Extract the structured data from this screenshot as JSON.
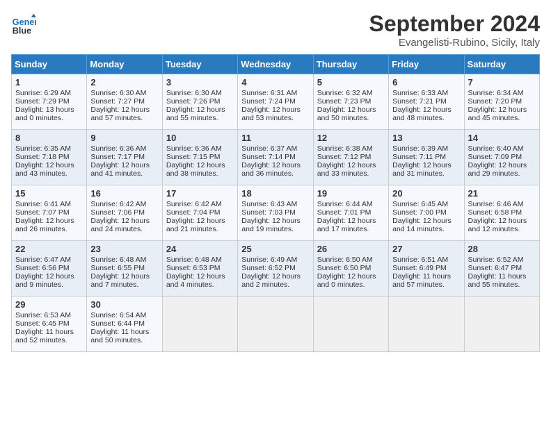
{
  "logo": {
    "line1": "General",
    "line2": "Blue"
  },
  "title": "September 2024",
  "subtitle": "Evangelisti-Rubino, Sicily, Italy",
  "days_header": [
    "Sunday",
    "Monday",
    "Tuesday",
    "Wednesday",
    "Thursday",
    "Friday",
    "Saturday"
  ],
  "weeks": [
    [
      {
        "day": "1",
        "sunrise": "6:29 AM",
        "sunset": "7:29 PM",
        "daylight": "13 hours and 0 minutes."
      },
      {
        "day": "2",
        "sunrise": "6:30 AM",
        "sunset": "7:27 PM",
        "daylight": "12 hours and 57 minutes."
      },
      {
        "day": "3",
        "sunrise": "6:30 AM",
        "sunset": "7:26 PM",
        "daylight": "12 hours and 55 minutes."
      },
      {
        "day": "4",
        "sunrise": "6:31 AM",
        "sunset": "7:24 PM",
        "daylight": "12 hours and 53 minutes."
      },
      {
        "day": "5",
        "sunrise": "6:32 AM",
        "sunset": "7:23 PM",
        "daylight": "12 hours and 50 minutes."
      },
      {
        "day": "6",
        "sunrise": "6:33 AM",
        "sunset": "7:21 PM",
        "daylight": "12 hours and 48 minutes."
      },
      {
        "day": "7",
        "sunrise": "6:34 AM",
        "sunset": "7:20 PM",
        "daylight": "12 hours and 45 minutes."
      }
    ],
    [
      {
        "day": "8",
        "sunrise": "6:35 AM",
        "sunset": "7:18 PM",
        "daylight": "12 hours and 43 minutes."
      },
      {
        "day": "9",
        "sunrise": "6:36 AM",
        "sunset": "7:17 PM",
        "daylight": "12 hours and 41 minutes."
      },
      {
        "day": "10",
        "sunrise": "6:36 AM",
        "sunset": "7:15 PM",
        "daylight": "12 hours and 38 minutes."
      },
      {
        "day": "11",
        "sunrise": "6:37 AM",
        "sunset": "7:14 PM",
        "daylight": "12 hours and 36 minutes."
      },
      {
        "day": "12",
        "sunrise": "6:38 AM",
        "sunset": "7:12 PM",
        "daylight": "12 hours and 33 minutes."
      },
      {
        "day": "13",
        "sunrise": "6:39 AM",
        "sunset": "7:11 PM",
        "daylight": "12 hours and 31 minutes."
      },
      {
        "day": "14",
        "sunrise": "6:40 AM",
        "sunset": "7:09 PM",
        "daylight": "12 hours and 29 minutes."
      }
    ],
    [
      {
        "day": "15",
        "sunrise": "6:41 AM",
        "sunset": "7:07 PM",
        "daylight": "12 hours and 26 minutes."
      },
      {
        "day": "16",
        "sunrise": "6:42 AM",
        "sunset": "7:06 PM",
        "daylight": "12 hours and 24 minutes."
      },
      {
        "day": "17",
        "sunrise": "6:42 AM",
        "sunset": "7:04 PM",
        "daylight": "12 hours and 21 minutes."
      },
      {
        "day": "18",
        "sunrise": "6:43 AM",
        "sunset": "7:03 PM",
        "daylight": "12 hours and 19 minutes."
      },
      {
        "day": "19",
        "sunrise": "6:44 AM",
        "sunset": "7:01 PM",
        "daylight": "12 hours and 17 minutes."
      },
      {
        "day": "20",
        "sunrise": "6:45 AM",
        "sunset": "7:00 PM",
        "daylight": "12 hours and 14 minutes."
      },
      {
        "day": "21",
        "sunrise": "6:46 AM",
        "sunset": "6:58 PM",
        "daylight": "12 hours and 12 minutes."
      }
    ],
    [
      {
        "day": "22",
        "sunrise": "6:47 AM",
        "sunset": "6:56 PM",
        "daylight": "12 hours and 9 minutes."
      },
      {
        "day": "23",
        "sunrise": "6:48 AM",
        "sunset": "6:55 PM",
        "daylight": "12 hours and 7 minutes."
      },
      {
        "day": "24",
        "sunrise": "6:48 AM",
        "sunset": "6:53 PM",
        "daylight": "12 hours and 4 minutes."
      },
      {
        "day": "25",
        "sunrise": "6:49 AM",
        "sunset": "6:52 PM",
        "daylight": "12 hours and 2 minutes."
      },
      {
        "day": "26",
        "sunrise": "6:50 AM",
        "sunset": "6:50 PM",
        "daylight": "12 hours and 0 minutes."
      },
      {
        "day": "27",
        "sunrise": "6:51 AM",
        "sunset": "6:49 PM",
        "daylight": "11 hours and 57 minutes."
      },
      {
        "day": "28",
        "sunrise": "6:52 AM",
        "sunset": "6:47 PM",
        "daylight": "11 hours and 55 minutes."
      }
    ],
    [
      {
        "day": "29",
        "sunrise": "6:53 AM",
        "sunset": "6:45 PM",
        "daylight": "11 hours and 52 minutes."
      },
      {
        "day": "30",
        "sunrise": "6:54 AM",
        "sunset": "6:44 PM",
        "daylight": "11 hours and 50 minutes."
      },
      null,
      null,
      null,
      null,
      null
    ]
  ]
}
